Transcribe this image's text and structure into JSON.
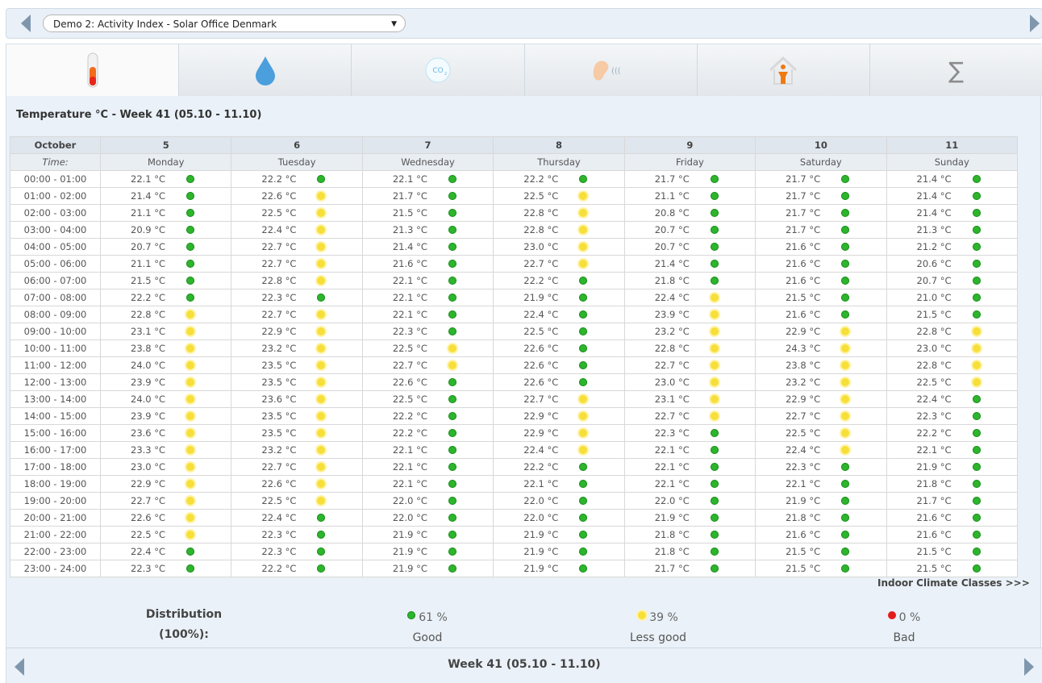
{
  "header": {
    "selector_value": "Demo 2: Activity Index - Solar Office Denmark"
  },
  "tabs": [
    {
      "icon": "thermometer-icon"
    },
    {
      "icon": "water-drop-icon"
    },
    {
      "icon": "co2-icon",
      "label": "CO2"
    },
    {
      "icon": "ear-sound-icon"
    },
    {
      "icon": "house-person-icon"
    },
    {
      "icon": "sigma-icon",
      "label": "∑"
    }
  ],
  "title": "Temperature °C - Week 41 (05.10 - 11.10)",
  "table": {
    "month": "October",
    "time_label": "Time:",
    "days": [
      {
        "date": "5",
        "name": "Monday"
      },
      {
        "date": "6",
        "name": "Tuesday"
      },
      {
        "date": "7",
        "name": "Wednesday"
      },
      {
        "date": "8",
        "name": "Thursday"
      },
      {
        "date": "9",
        "name": "Friday"
      },
      {
        "date": "10",
        "name": "Saturday"
      },
      {
        "date": "11",
        "name": "Sunday"
      }
    ],
    "rows": [
      {
        "time": "00:00 - 01:00",
        "cells": [
          [
            "22.1 °C",
            "g"
          ],
          [
            "22.2 °C",
            "g"
          ],
          [
            "22.1 °C",
            "g"
          ],
          [
            "22.2 °C",
            "g"
          ],
          [
            "21.7 °C",
            "g"
          ],
          [
            "21.7 °C",
            "g"
          ],
          [
            "21.4 °C",
            "g"
          ]
        ]
      },
      {
        "time": "01:00 - 02:00",
        "cells": [
          [
            "21.4 °C",
            "g"
          ],
          [
            "22.6 °C",
            "y"
          ],
          [
            "21.7 °C",
            "g"
          ],
          [
            "22.5 °C",
            "y"
          ],
          [
            "21.1 °C",
            "g"
          ],
          [
            "21.7 °C",
            "g"
          ],
          [
            "21.4 °C",
            "g"
          ]
        ]
      },
      {
        "time": "02:00 - 03:00",
        "cells": [
          [
            "21.1 °C",
            "g"
          ],
          [
            "22.5 °C",
            "y"
          ],
          [
            "21.5 °C",
            "g"
          ],
          [
            "22.8 °C",
            "y"
          ],
          [
            "20.8 °C",
            "g"
          ],
          [
            "21.7 °C",
            "g"
          ],
          [
            "21.4 °C",
            "g"
          ]
        ]
      },
      {
        "time": "03:00 - 04:00",
        "cells": [
          [
            "20.9 °C",
            "g"
          ],
          [
            "22.4 °C",
            "y"
          ],
          [
            "21.3 °C",
            "g"
          ],
          [
            "22.8 °C",
            "y"
          ],
          [
            "20.7 °C",
            "g"
          ],
          [
            "21.7 °C",
            "g"
          ],
          [
            "21.3 °C",
            "g"
          ]
        ]
      },
      {
        "time": "04:00 - 05:00",
        "cells": [
          [
            "20.7 °C",
            "g"
          ],
          [
            "22.7 °C",
            "y"
          ],
          [
            "21.4 °C",
            "g"
          ],
          [
            "23.0 °C",
            "y"
          ],
          [
            "20.7 °C",
            "g"
          ],
          [
            "21.6 °C",
            "g"
          ],
          [
            "21.2 °C",
            "g"
          ]
        ]
      },
      {
        "time": "05:00 - 06:00",
        "cells": [
          [
            "21.1 °C",
            "g"
          ],
          [
            "22.7 °C",
            "y"
          ],
          [
            "21.6 °C",
            "g"
          ],
          [
            "22.7 °C",
            "y"
          ],
          [
            "21.4 °C",
            "g"
          ],
          [
            "21.6 °C",
            "g"
          ],
          [
            "20.6 °C",
            "g"
          ]
        ]
      },
      {
        "time": "06:00 - 07:00",
        "cells": [
          [
            "21.5 °C",
            "g"
          ],
          [
            "22.8 °C",
            "y"
          ],
          [
            "22.1 °C",
            "g"
          ],
          [
            "22.2 °C",
            "g"
          ],
          [
            "21.8 °C",
            "g"
          ],
          [
            "21.6 °C",
            "g"
          ],
          [
            "20.7 °C",
            "g"
          ]
        ]
      },
      {
        "time": "07:00 - 08:00",
        "cells": [
          [
            "22.2 °C",
            "g"
          ],
          [
            "22.3 °C",
            "g"
          ],
          [
            "22.1 °C",
            "g"
          ],
          [
            "21.9 °C",
            "g"
          ],
          [
            "22.4 °C",
            "y"
          ],
          [
            "21.5 °C",
            "g"
          ],
          [
            "21.0 °C",
            "g"
          ]
        ]
      },
      {
        "time": "08:00 - 09:00",
        "cells": [
          [
            "22.8 °C",
            "y"
          ],
          [
            "22.7 °C",
            "y"
          ],
          [
            "22.1 °C",
            "g"
          ],
          [
            "22.4 °C",
            "g"
          ],
          [
            "23.9 °C",
            "y"
          ],
          [
            "21.6 °C",
            "g"
          ],
          [
            "21.5 °C",
            "g"
          ]
        ]
      },
      {
        "time": "09:00 - 10:00",
        "cells": [
          [
            "23.1 °C",
            "y"
          ],
          [
            "22.9 °C",
            "y"
          ],
          [
            "22.3 °C",
            "g"
          ],
          [
            "22.5 °C",
            "g"
          ],
          [
            "23.2 °C",
            "y"
          ],
          [
            "22.9 °C",
            "y"
          ],
          [
            "22.8 °C",
            "y"
          ]
        ]
      },
      {
        "time": "10:00 - 11:00",
        "cells": [
          [
            "23.8 °C",
            "y"
          ],
          [
            "23.2 °C",
            "y"
          ],
          [
            "22.5 °C",
            "y"
          ],
          [
            "22.6 °C",
            "g"
          ],
          [
            "22.8 °C",
            "y"
          ],
          [
            "24.3 °C",
            "y"
          ],
          [
            "23.0 °C",
            "y"
          ]
        ]
      },
      {
        "time": "11:00 - 12:00",
        "cells": [
          [
            "24.0 °C",
            "y"
          ],
          [
            "23.5 °C",
            "y"
          ],
          [
            "22.7 °C",
            "y"
          ],
          [
            "22.6 °C",
            "g"
          ],
          [
            "22.7 °C",
            "y"
          ],
          [
            "23.8 °C",
            "y"
          ],
          [
            "22.8 °C",
            "y"
          ]
        ]
      },
      {
        "time": "12:00 - 13:00",
        "cells": [
          [
            "23.9 °C",
            "y"
          ],
          [
            "23.5 °C",
            "y"
          ],
          [
            "22.6 °C",
            "g"
          ],
          [
            "22.6 °C",
            "g"
          ],
          [
            "23.0 °C",
            "y"
          ],
          [
            "23.2 °C",
            "y"
          ],
          [
            "22.5 °C",
            "y"
          ]
        ]
      },
      {
        "time": "13:00 - 14:00",
        "cells": [
          [
            "24.0 °C",
            "y"
          ],
          [
            "23.6 °C",
            "y"
          ],
          [
            "22.5 °C",
            "g"
          ],
          [
            "22.7 °C",
            "y"
          ],
          [
            "23.1 °C",
            "y"
          ],
          [
            "22.9 °C",
            "y"
          ],
          [
            "22.4 °C",
            "g"
          ]
        ]
      },
      {
        "time": "14:00 - 15:00",
        "cells": [
          [
            "23.9 °C",
            "y"
          ],
          [
            "23.5 °C",
            "y"
          ],
          [
            "22.2 °C",
            "g"
          ],
          [
            "22.9 °C",
            "y"
          ],
          [
            "22.7 °C",
            "y"
          ],
          [
            "22.7 °C",
            "y"
          ],
          [
            "22.3 °C",
            "g"
          ]
        ]
      },
      {
        "time": "15:00 - 16:00",
        "cells": [
          [
            "23.6 °C",
            "y"
          ],
          [
            "23.5 °C",
            "y"
          ],
          [
            "22.2 °C",
            "g"
          ],
          [
            "22.9 °C",
            "y"
          ],
          [
            "22.3 °C",
            "g"
          ],
          [
            "22.5 °C",
            "y"
          ],
          [
            "22.2 °C",
            "g"
          ]
        ]
      },
      {
        "time": "16:00 - 17:00",
        "cells": [
          [
            "23.3 °C",
            "y"
          ],
          [
            "23.2 °C",
            "y"
          ],
          [
            "22.1 °C",
            "g"
          ],
          [
            "22.4 °C",
            "y"
          ],
          [
            "22.1 °C",
            "g"
          ],
          [
            "22.4 °C",
            "y"
          ],
          [
            "22.1 °C",
            "g"
          ]
        ]
      },
      {
        "time": "17:00 - 18:00",
        "cells": [
          [
            "23.0 °C",
            "y"
          ],
          [
            "22.7 °C",
            "y"
          ],
          [
            "22.1 °C",
            "g"
          ],
          [
            "22.2 °C",
            "g"
          ],
          [
            "22.1 °C",
            "g"
          ],
          [
            "22.3 °C",
            "g"
          ],
          [
            "21.9 °C",
            "g"
          ]
        ]
      },
      {
        "time": "18:00 - 19:00",
        "cells": [
          [
            "22.9 °C",
            "y"
          ],
          [
            "22.6 °C",
            "y"
          ],
          [
            "22.1 °C",
            "g"
          ],
          [
            "22.1 °C",
            "g"
          ],
          [
            "22.1 °C",
            "g"
          ],
          [
            "22.1 °C",
            "g"
          ],
          [
            "21.8 °C",
            "g"
          ]
        ]
      },
      {
        "time": "19:00 - 20:00",
        "cells": [
          [
            "22.7 °C",
            "y"
          ],
          [
            "22.5 °C",
            "y"
          ],
          [
            "22.0 °C",
            "g"
          ],
          [
            "22.0 °C",
            "g"
          ],
          [
            "22.0 °C",
            "g"
          ],
          [
            "21.9 °C",
            "g"
          ],
          [
            "21.7 °C",
            "g"
          ]
        ]
      },
      {
        "time": "20:00 - 21:00",
        "cells": [
          [
            "22.6 °C",
            "y"
          ],
          [
            "22.4 °C",
            "g"
          ],
          [
            "22.0 °C",
            "g"
          ],
          [
            "22.0 °C",
            "g"
          ],
          [
            "21.9 °C",
            "g"
          ],
          [
            "21.8 °C",
            "g"
          ],
          [
            "21.6 °C",
            "g"
          ]
        ]
      },
      {
        "time": "21:00 - 22:00",
        "cells": [
          [
            "22.5 °C",
            "y"
          ],
          [
            "22.3 °C",
            "g"
          ],
          [
            "21.9 °C",
            "g"
          ],
          [
            "21.9 °C",
            "g"
          ],
          [
            "21.8 °C",
            "g"
          ],
          [
            "21.6 °C",
            "g"
          ],
          [
            "21.6 °C",
            "g"
          ]
        ]
      },
      {
        "time": "22:00 - 23:00",
        "cells": [
          [
            "22.4 °C",
            "g"
          ],
          [
            "22.3 °C",
            "g"
          ],
          [
            "21.9 °C",
            "g"
          ],
          [
            "21.9 °C",
            "g"
          ],
          [
            "21.8 °C",
            "g"
          ],
          [
            "21.5 °C",
            "g"
          ],
          [
            "21.5 °C",
            "g"
          ]
        ]
      },
      {
        "time": "23:00 - 24:00",
        "cells": [
          [
            "22.3 °C",
            "g"
          ],
          [
            "22.2 °C",
            "g"
          ],
          [
            "21.9 °C",
            "g"
          ],
          [
            "21.9 °C",
            "g"
          ],
          [
            "21.7 °C",
            "g"
          ],
          [
            "21.5 °C",
            "g"
          ],
          [
            "21.5 °C",
            "g"
          ]
        ]
      }
    ]
  },
  "classes_link": "Indoor Climate Classes >>>",
  "distribution": {
    "label_line1": "Distribution",
    "label_line2": "(100%):",
    "good": {
      "pct": "61 %",
      "label": "Good",
      "color": "#2db52d"
    },
    "less_good": {
      "pct": "39 %",
      "label": "Less good",
      "color": "#f7df3a"
    },
    "bad": {
      "pct": "0 %",
      "label": "Bad",
      "color": "#e31b1b"
    }
  },
  "footer": {
    "week_label": "Week 41 (05.10 - 11.10)"
  }
}
